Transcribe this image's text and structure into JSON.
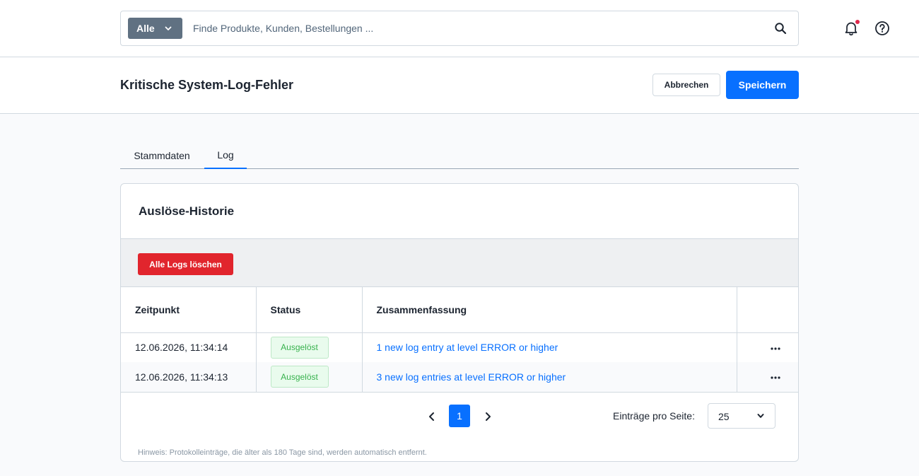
{
  "search": {
    "type_label": "Alle",
    "placeholder": "Finde Produkte, Kunden, Bestellungen ..."
  },
  "header": {
    "title": "Kritische System-Log-Fehler",
    "cancel_label": "Abbrechen",
    "save_label": "Speichern"
  },
  "tabs": [
    {
      "label": "Stammdaten",
      "active": false
    },
    {
      "label": "Log",
      "active": true
    }
  ],
  "card": {
    "title": "Auslöse-Historie",
    "delete_all_label": "Alle Logs löschen",
    "columns": [
      "Zeitpunkt",
      "Status",
      "Zusammenfassung",
      ""
    ],
    "rows": [
      {
        "time": "12.06.2026, 11:34:14",
        "status": "Ausgelöst",
        "summary": "1 new log entry at level ERROR or higher"
      },
      {
        "time": "12.06.2026, 11:34:13",
        "status": "Ausgelöst",
        "summary": "3 new log entries at level ERROR or higher"
      }
    ],
    "pagination": {
      "current_page": "1",
      "per_page_label": "Einträge pro Seite:",
      "per_page_value": "25"
    },
    "hint": "Hinweis: Protokolleinträge, die älter als 180 Tage sind, werden automatisch entfernt."
  },
  "colors": {
    "primary": "#0870ff",
    "danger": "#e1252d",
    "success": "#37b24d",
    "notification_dot": "#de294c"
  }
}
